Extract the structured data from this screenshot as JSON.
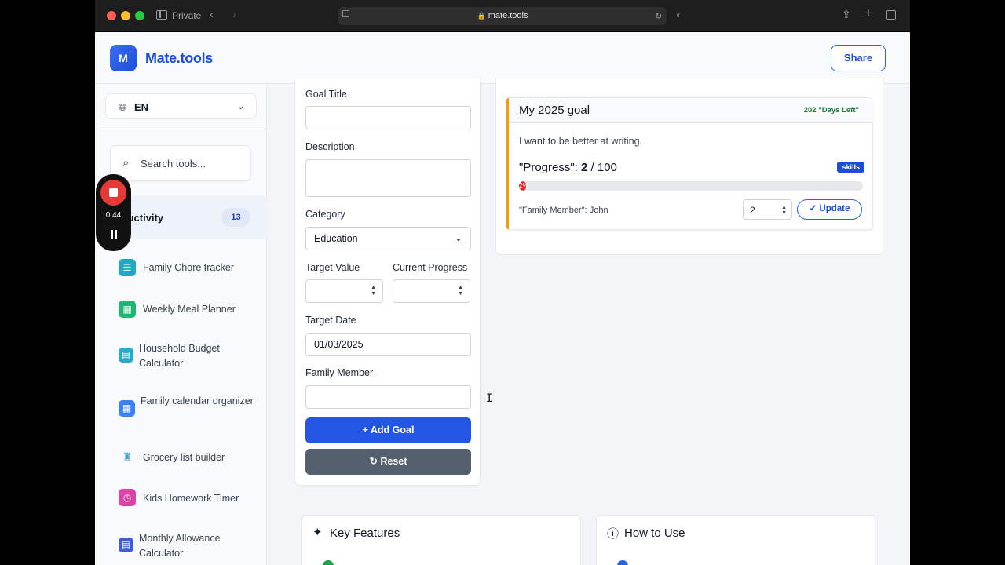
{
  "browser": {
    "private_label": "Private",
    "url": "mate.tools"
  },
  "header": {
    "logo_letter": "M",
    "logo_text": "Mate.tools",
    "share_label": "Share"
  },
  "sidebar": {
    "language": "EN",
    "search_placeholder": "Search tools...",
    "category": {
      "label": "luctivity",
      "count": "13"
    },
    "tools": [
      {
        "label": "Family Chore tracker",
        "icon": "checklist-icon",
        "color": "#22a7c4"
      },
      {
        "label": "Weekly Meal Planner",
        "icon": "calendar-icon",
        "color": "#22b573"
      },
      {
        "label": "Household Budget Calculator",
        "icon": "calculator-icon",
        "color": "#2aa9c9"
      },
      {
        "label": "Family calendar organizer",
        "icon": "calendar-icon",
        "color": "#3b82f6"
      },
      {
        "label": "Grocery list builder",
        "icon": "cart-icon",
        "color": "#4fa3d1"
      },
      {
        "label": "Kids Homework Timer",
        "icon": "clock-icon",
        "color": "#d946a8"
      },
      {
        "label": "Monthly Allowance Calculator",
        "icon": "calculator-icon",
        "color": "#3b5bdb"
      }
    ]
  },
  "recorder": {
    "time": "0:44"
  },
  "form": {
    "goal_title_label": "Goal Title",
    "goal_title_value": "",
    "description_label": "Description",
    "description_value": "",
    "category_label": "Category",
    "category_value": "Education",
    "target_value_label": "Target Value",
    "target_value": "",
    "current_progress_label": "Current Progress",
    "current_progress_value": "",
    "target_date_label": "Target Date",
    "target_date_value": "01/03/2025",
    "family_member_label": "Family Member",
    "family_member_value": "",
    "add_goal_label": "Add Goal",
    "reset_label": "Reset"
  },
  "goal": {
    "title": "My 2025 goal",
    "days_left": "202 \"Days Left\"",
    "description": "I want to be better at writing.",
    "progress_prefix": "\"Progress\": ",
    "progress_current": "2",
    "progress_target": " / 100",
    "progress_fraction": 0.02,
    "progress_bar_text": "2%",
    "badge": "skills",
    "member": "\"Family Member\": John",
    "update_value": "2",
    "update_label": "Update",
    "accent_color": "#f59e0b"
  },
  "bottom": {
    "features_title": "Key Features",
    "how_title": "How to Use"
  }
}
